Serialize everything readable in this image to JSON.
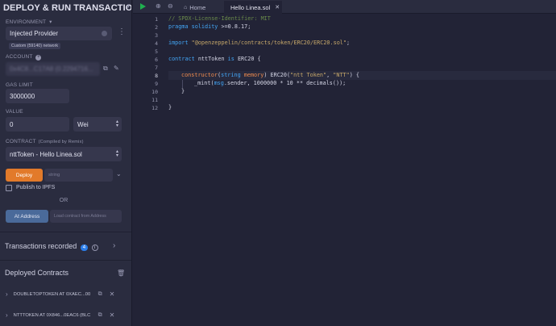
{
  "panel": {
    "title": "DEPLOY & RUN TRANSACTIONS",
    "environment_label": "ENVIRONMENT",
    "environment_value": "Injected Provider",
    "network_tag": "Custom (59140) network",
    "account_label": "ACCOUNT",
    "account_value": "0x4C8...C17A8 (0.2294716...",
    "gas_limit_label": "GAS LIMIT",
    "gas_limit_value": "3000000",
    "value_label": "VALUE",
    "value_amount": "0",
    "value_unit": "Wei",
    "contract_label": "CONTRACT",
    "contract_note": "(Compiled by Remix)",
    "contract_value": "nttToken - Hello Linea.sol",
    "deploy_button": "Deploy",
    "deploy_input_placeholder": "string",
    "publish_label": "Publish to IPFS",
    "or_label": "OR",
    "at_address_button": "At Address",
    "at_address_placeholder": "Load contract from Address",
    "transactions_label": "Transactions recorded",
    "transactions_count": "4",
    "deployed_label": "Deployed Contracts",
    "deployed_items": [
      "DOUBLETOPTOKEN AT 0XAEC...00",
      "NTTTOKEN AT 0X846...0EAC6 (BLC"
    ]
  },
  "editor": {
    "tabs": [
      "Home",
      "Hello Linea.sol"
    ],
    "active_tab": "Hello Linea.sol",
    "line_numbers": [
      "1",
      "2",
      "3",
      "4",
      "5",
      "6",
      "7",
      "8",
      "9",
      "10",
      "11",
      "12"
    ],
    "code": {
      "l1": "// SPDX-License-Identifier: MIT",
      "l2_kw": "pragma solidity",
      "l2_rest": " >=0.8.17;",
      "l4_kw": "import",
      "l4_str": " \"@openzeppelin/contracts/token/ERC20/ERC20.sol\"",
      "l4_end": ";",
      "l6_kw": "contract",
      "l6_name": " nttToken ",
      "l6_is": "is",
      "l6_rest": " ERC20 {",
      "l8_kw": "constructor",
      "l8_a": "(",
      "l8_type": "string",
      "l8_mem": " memory",
      "l8_b": ") ERC20(",
      "l8_s1": "\"ntt Token\"",
      "l8_c": ", ",
      "l8_s2": "\"NTT\"",
      "l8_d": ") {",
      "l9_a": "_mint(",
      "l9_kw": "msg",
      "l9_b": ".sender, 1000000 * 10 ** decimals());",
      "l10": "}",
      "l12": "}"
    }
  },
  "colors": {
    "panel_bg": "#2a2c3f",
    "editor_bg": "#222336",
    "accent_orange": "#e27a2a",
    "check_green": "#1fb04f",
    "badge_blue": "#2b7de9"
  }
}
